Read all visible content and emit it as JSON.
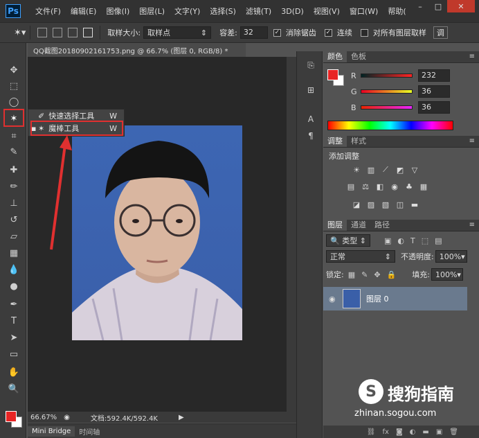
{
  "app": {
    "logo": "Ps"
  },
  "menu": [
    "文件(F)",
    "编辑(E)",
    "图像(I)",
    "图层(L)",
    "文字(Y)",
    "选择(S)",
    "滤镜(T)",
    "3D(D)",
    "视图(V)",
    "窗口(W)",
    "帮助("
  ],
  "options": {
    "sample_size_label": "取样大小:",
    "sample_size_value": "取样点",
    "tolerance_label": "容差:",
    "tolerance_value": "32",
    "antialias_label": "消除锯齿",
    "contiguous_label": "连续",
    "all_layers_label": "对所有图层取样",
    "refine_label": "调"
  },
  "document": {
    "tab_title": "QQ截图20180902161753.png @ 66.7% (图层 0, RGB/8) *",
    "zoom": "66.67%",
    "doc_info": "文档:592.4K/592.4K"
  },
  "bottom_tabs": [
    "Mini Bridge",
    "时间轴"
  ],
  "flyout": {
    "items": [
      {
        "label": "快速选择工具",
        "key": "W"
      },
      {
        "label": "魔棒工具",
        "key": "W"
      }
    ]
  },
  "color_panel": {
    "tabs": [
      "颜色",
      "色板"
    ],
    "r_label": "R",
    "g_label": "G",
    "b_label": "B",
    "r": "232",
    "g": "36",
    "b": "36"
  },
  "adjust_panel": {
    "tabs": [
      "调整",
      "样式"
    ],
    "title": "添加调整"
  },
  "layers_panel": {
    "tabs": [
      "图层",
      "通道",
      "路径"
    ],
    "filter_label": "类型",
    "blend_mode": "正常",
    "opacity_label": "不透明度:",
    "opacity_value": "100%",
    "lock_label": "锁定:",
    "fill_label": "填充:",
    "fill_value": "100%",
    "layer_name": "图层 0"
  },
  "watermark": {
    "name": "搜狗指南",
    "url": "zhinan.sogou.com"
  },
  "colors": {
    "foreground": "#e82424",
    "background": "#ffffff",
    "accent": "#e03030"
  }
}
